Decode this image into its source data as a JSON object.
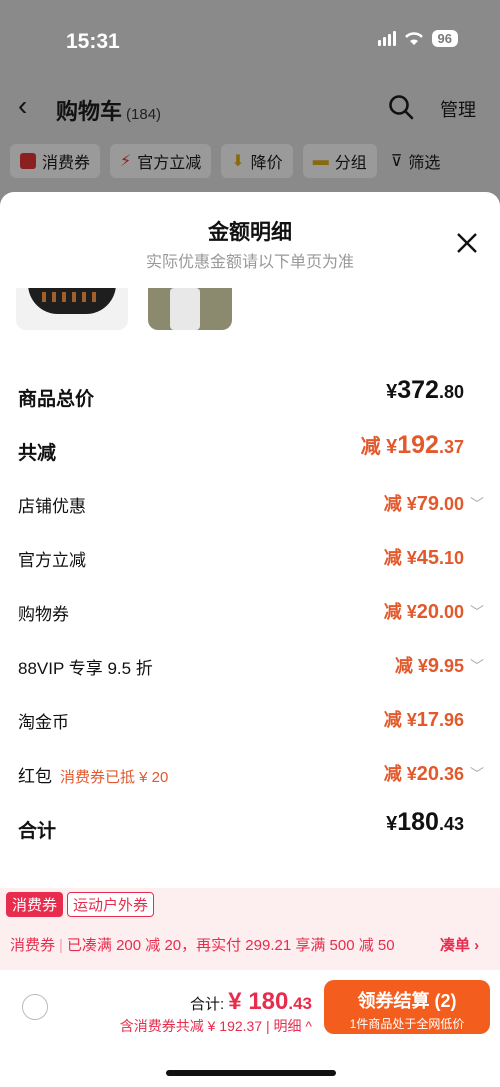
{
  "status_bar": {
    "time": "15:31",
    "battery": "96"
  },
  "nav": {
    "title": "购物车",
    "count": "(184)",
    "manage": "管理"
  },
  "filters": [
    {
      "label": "消费券"
    },
    {
      "label": "官方立减"
    },
    {
      "label": "降价"
    },
    {
      "label": "分组"
    },
    {
      "label": "筛选"
    }
  ],
  "sheet": {
    "title": "金额明细",
    "subtitle": "实际优惠金额请以下单页为准"
  },
  "rows": {
    "subtotal": {
      "label": "商品总价",
      "yen": "¥",
      "int": "372",
      "dec": ".80"
    },
    "total_discount": {
      "label": "共减",
      "prefix": "减 ",
      "yen": "¥",
      "int": "192",
      "dec": ".37"
    },
    "store": {
      "label": "店铺优惠",
      "prefix": "减 ",
      "yen": "¥",
      "int": "79",
      "dec": ".00"
    },
    "official": {
      "label": "官方立减",
      "prefix": "减 ",
      "yen": "¥",
      "int": "45",
      "dec": ".10"
    },
    "voucher": {
      "label": "购物券",
      "prefix": "减 ",
      "yen": "¥",
      "int": "20",
      "dec": ".00"
    },
    "vip": {
      "label": "88VIP 专享 9.5 折",
      "prefix": "减 ",
      "yen": "¥",
      "int": "9",
      "dec": ".95"
    },
    "coins": {
      "label": "淘金币",
      "prefix": "减 ",
      "yen": "¥",
      "int": "17",
      "dec": ".96"
    },
    "redpacket": {
      "label": "红包",
      "sub": "消费券已抵 ¥ 20",
      "prefix": "减 ",
      "yen": "¥",
      "int": "20",
      "dec": ".36"
    },
    "sum": {
      "label": "合计",
      "yen": "¥",
      "int": "180",
      "dec": ".43"
    }
  },
  "promo": {
    "tag1": "消费券",
    "tag2": "运动户外券",
    "part1": "消费券",
    "part2": "已凑满 200 减 20，再实付 299.21 享满 500 减 50",
    "go": "凑单 ›"
  },
  "bottom": {
    "total_label": "合计: ",
    "yen": "¥ ",
    "total_int": "180",
    "total_dec": ".43",
    "sub": "含消费券共减 ¥ 192.37",
    "detail": "明细 ^",
    "checkout_main": "领券结算 (2)",
    "checkout_sub": "1件商品处于全网低价"
  },
  "colors": {
    "accent": "#e2592c",
    "brand_red": "#e82c4d",
    "checkout": "#f35e1f"
  }
}
